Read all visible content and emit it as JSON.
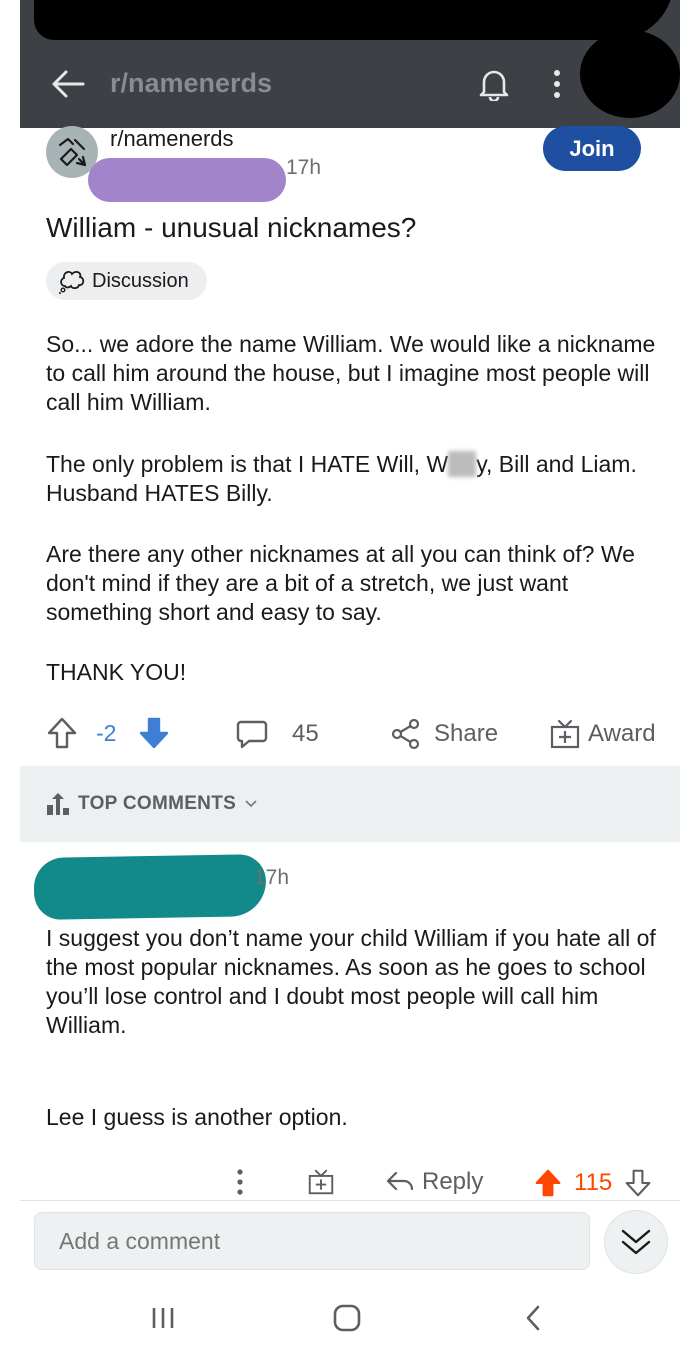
{
  "appbar": {
    "title": "r/namenerds",
    "back_icon": "arrow-left-icon",
    "bell_icon": "bell-icon",
    "more_icon": "more-vertical-icon"
  },
  "post": {
    "subreddit": "r/namenerds",
    "time": "17h",
    "join_label": "Join",
    "title": "William - unusual nicknames?",
    "flair": "Discussion",
    "paragraphs": {
      "p1": "So... we adore the name William. We would like a nickname to call him around the house, but I imagine most people will call him William.",
      "p2_before": "The only problem is that I HATE Will, W",
      "p2_after": "y, Bill and Liam.",
      "p2_line2": "Husband HATES Billy.",
      "p3": "Are there any other nicknames at all you can think of? We don't mind if they are a bit of a stretch, we just want something short and easy to say.",
      "p4": "THANK YOU!"
    },
    "actions": {
      "votes": "-2",
      "comments": "45",
      "share": "Share",
      "award": "Award"
    }
  },
  "comments_header": {
    "sort_label": "TOP COMMENTS"
  },
  "comment": {
    "time": "17h",
    "p1": "I suggest you don’t name your child William if you hate all of the most popular nicknames. As soon as he goes to school you’ll lose control and I doubt most people will call him William.",
    "p2": "Lee I guess is another option.",
    "reply": "Reply",
    "score": "115"
  },
  "composer": {
    "placeholder": "Add a comment"
  },
  "colors": {
    "appbar": "#3d4145",
    "join": "#1f4fa1",
    "upvote": "#ff4500",
    "downvote": "#3f7ed6",
    "user_redaction": "#a184c9",
    "commenter_redaction": "#128a8a"
  }
}
